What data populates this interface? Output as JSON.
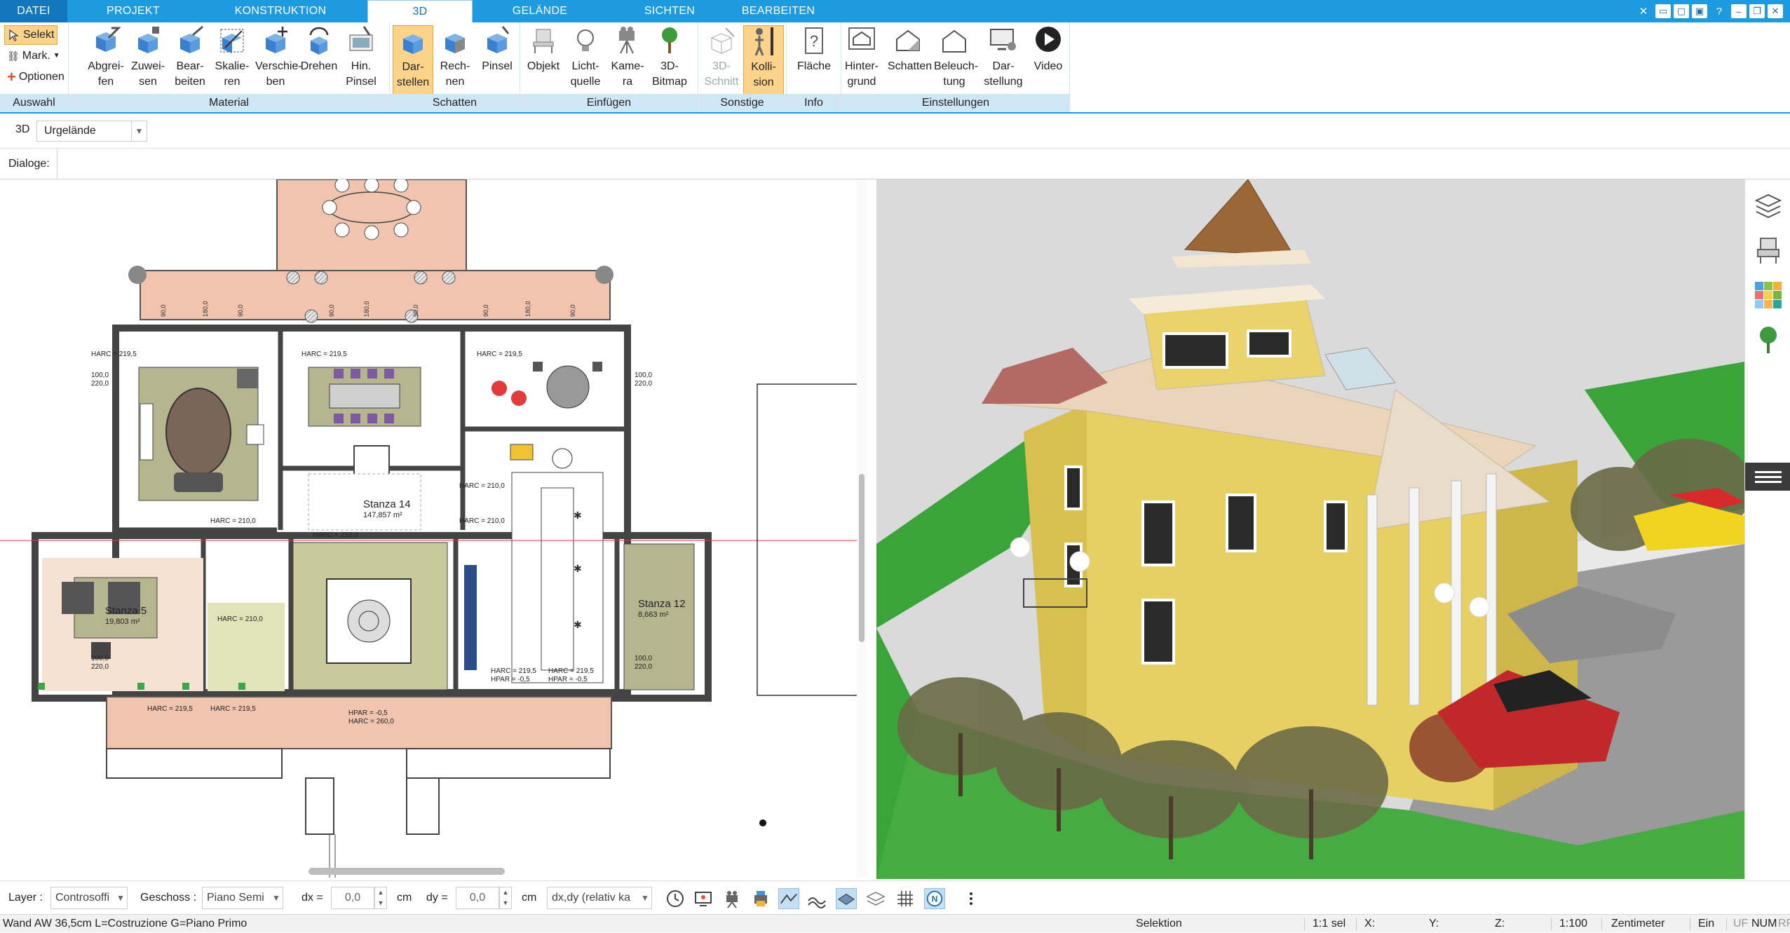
{
  "tabs": [
    {
      "label": "DATEI"
    },
    {
      "label": "PROJEKT"
    },
    {
      "label": "KONSTRUKTION"
    },
    {
      "label": "3D"
    },
    {
      "label": "GELÄNDE"
    },
    {
      "label": "SICHTEN"
    },
    {
      "label": "BEARBEITEN"
    }
  ],
  "ribbon": {
    "auswahl": {
      "label": "Auswahl",
      "select": "Selekt",
      "mark": "Mark.",
      "options": "Optionen"
    },
    "material": {
      "label": "Material",
      "buttons": [
        "Abgrei-\nfen",
        "Zuwei-\nsen",
        "Bear-\nbeiten",
        "Skalie-\nren",
        "Verschie-\nben",
        "Drehen",
        "Hin.\nPinsel"
      ]
    },
    "schatten": {
      "label": "Schatten",
      "buttons": [
        "Dar-\nstellen",
        "Rech-\nnen",
        "Pinsel"
      ]
    },
    "einfuegen": {
      "label": "Einfügen",
      "buttons": [
        "Objekt",
        "Licht-\nquelle",
        "Kame-\nra",
        "3D-\nBitmap"
      ]
    },
    "sonstige": {
      "label": "Sonstige",
      "buttons": [
        "3D-\nSchnitt",
        "Kolli-\nsion"
      ]
    },
    "info": {
      "label": "Info",
      "buttons": [
        "Fläche"
      ]
    },
    "einstellungen": {
      "label": "Einstellungen",
      "buttons": [
        "Hinter-\ngrund",
        "Schatten",
        "Beleuch-\ntung",
        "Dar-\nstellung",
        "Video"
      ]
    }
  },
  "toolbar3d": {
    "mode": "3D",
    "terrain": "Urgelände"
  },
  "dialoge": {
    "label": "Dialoge:"
  },
  "plan": {
    "room14_name": "Stanza 14",
    "room14_area": "147,857 m²",
    "room5_name": "Stanza 5",
    "room5_area": "19,803 m²",
    "room12_name": "Stanza 12",
    "room12_area": "8,663 m²",
    "harc210": "HARC = 210,0",
    "harc2195": "HARC = 219,5",
    "harc260": "HARC = 260,0",
    "hpar": "HPAR = -0,5",
    "dim90": "90,0",
    "dim100": "100,0",
    "dim180": "180,0",
    "dim220": "220,0"
  },
  "bottom": {
    "layer_label": "Layer :",
    "layer_value": "Controsoffi",
    "floor_label": "Geschoss :",
    "floor_value": "Piano Semi",
    "dx_label": "dx =",
    "dx_value": "0,0",
    "dx_unit": "cm",
    "dy_label": "dy =",
    "dy_value": "0,0",
    "dy_unit": "cm",
    "coord_mode": "dx,dy (relativ ka"
  },
  "status": {
    "info": "Wand AW 36,5cm L=Costruzione G=Piano Primo",
    "mode": "Selektion",
    "sel": "1:1 sel",
    "x": "X:",
    "y": "Y:",
    "z": "Z:",
    "scale": "1:100",
    "unit": "Zentimeter",
    "ein": "Ein",
    "uf": "UF",
    "num": "NUM",
    "rf": "RF"
  }
}
